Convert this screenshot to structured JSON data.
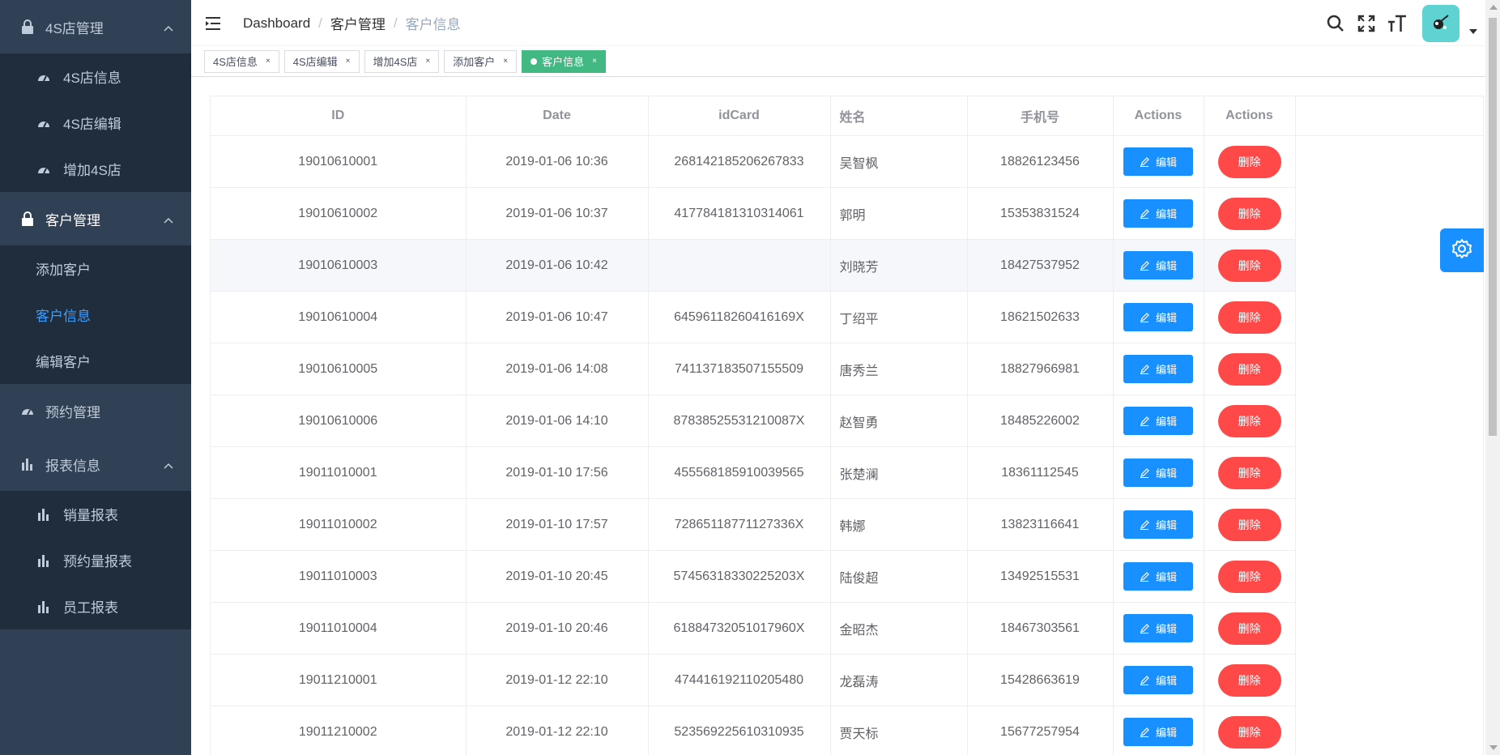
{
  "sidebar": {
    "groups": [
      {
        "title": "4S店管理",
        "icon": "lock-icon",
        "items": [
          {
            "label": "4S店信息",
            "icon": "dashboard-icon"
          },
          {
            "label": "4S店编辑",
            "icon": "dashboard-icon"
          },
          {
            "label": "增加4S店",
            "icon": "dashboard-icon"
          }
        ]
      },
      {
        "title": "客户管理",
        "icon": "lock-icon",
        "items": [
          {
            "label": "添加客户"
          },
          {
            "label": "客户信息",
            "active": true
          },
          {
            "label": "编辑客户"
          }
        ]
      },
      {
        "title": "预约管理",
        "icon": "dashboard-icon"
      },
      {
        "title": "报表信息",
        "icon": "chart-icon",
        "items": [
          {
            "label": "销量报表",
            "icon": "chart-icon"
          },
          {
            "label": "预约量报表",
            "icon": "chart-icon"
          },
          {
            "label": "员工报表",
            "icon": "chart-icon"
          }
        ]
      }
    ]
  },
  "header": {
    "breadcrumb": [
      "Dashboard",
      "客户管理",
      "客户信息"
    ]
  },
  "tags": [
    {
      "label": "4S店信息",
      "close": "×"
    },
    {
      "label": "4S店编辑",
      "close": "×"
    },
    {
      "label": "增加4S店",
      "close": "×"
    },
    {
      "label": "添加客户",
      "close": "×"
    },
    {
      "label": "客户信息",
      "close": "×",
      "active": true
    }
  ],
  "table": {
    "columns": [
      "ID",
      "Date",
      "idCard",
      "姓名",
      "手机号",
      "Actions",
      "Actions"
    ],
    "edit_label": "编辑",
    "delete_label": "删除",
    "rows": [
      {
        "id": "19010610001",
        "date": "2019-01-06 10:36",
        "idcard": "268142185206267833",
        "name": "吴智枫",
        "phone": "18826123456"
      },
      {
        "id": "19010610002",
        "date": "2019-01-06 10:37",
        "idcard": "417784181310314061",
        "name": "郭明",
        "phone": "15353831524"
      },
      {
        "id": "19010610003",
        "date": "2019-01-06 10:42",
        "idcard": "",
        "name": "刘晓芳",
        "phone": "18427537952"
      },
      {
        "id": "19010610004",
        "date": "2019-01-06 10:47",
        "idcard": "64596118260416169X",
        "name": "丁绍平",
        "phone": "18621502633"
      },
      {
        "id": "19010610005",
        "date": "2019-01-06 14:08",
        "idcard": "741137183507155509",
        "name": "唐秀兰",
        "phone": "18827966981"
      },
      {
        "id": "19010610006",
        "date": "2019-01-06 14:10",
        "idcard": "87838525531210087X",
        "name": "赵智勇",
        "phone": "18485226002"
      },
      {
        "id": "19011010001",
        "date": "2019-01-10 17:56",
        "idcard": "455568185910039565",
        "name": "张楚澜",
        "phone": "18361112545"
      },
      {
        "id": "19011010002",
        "date": "2019-01-10 17:57",
        "idcard": "72865118771127336X",
        "name": "韩娜",
        "phone": "13823116641"
      },
      {
        "id": "19011010003",
        "date": "2019-01-10 20:45",
        "idcard": "57456318330225203X",
        "name": "陆俊超",
        "phone": "13492515531"
      },
      {
        "id": "19011010004",
        "date": "2019-01-10 20:46",
        "idcard": "61884732051017960X",
        "name": "金昭杰",
        "phone": "18467303561"
      },
      {
        "id": "19011210001",
        "date": "2019-01-12 22:10",
        "idcard": "474416192110205480",
        "name": "龙磊涛",
        "phone": "15428663619"
      },
      {
        "id": "19011210002",
        "date": "2019-01-12 22:10",
        "idcard": "523569225610310935",
        "name": "贾天标",
        "phone": "15677257954"
      }
    ]
  },
  "colors": {
    "sidebar_bg": "#304156",
    "submenu_bg": "#1f2d3d",
    "active_text": "#409eff",
    "tag_active": "#42b983",
    "edit_button": "#1890ff",
    "delete_button": "#ff4949"
  }
}
